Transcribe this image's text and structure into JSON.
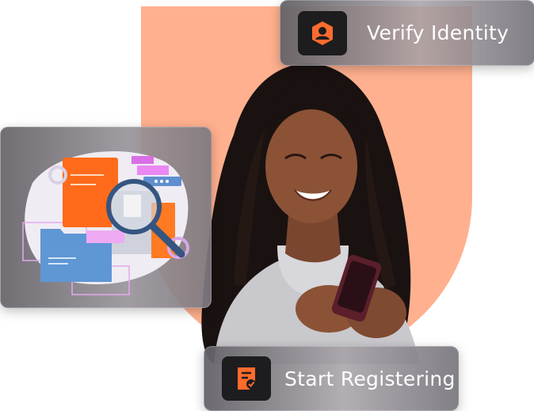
{
  "cards": {
    "verify_label": "Verify Identity",
    "register_label": "Start Registering"
  },
  "icons": {
    "verify": "user-shield-icon",
    "register": "document-check-icon",
    "illustration": "documents-magnifier-illustration"
  },
  "colors": {
    "arch": "#ffb08f",
    "accent": "#ff6b2c",
    "icon_bg": "#1d1c1f"
  }
}
